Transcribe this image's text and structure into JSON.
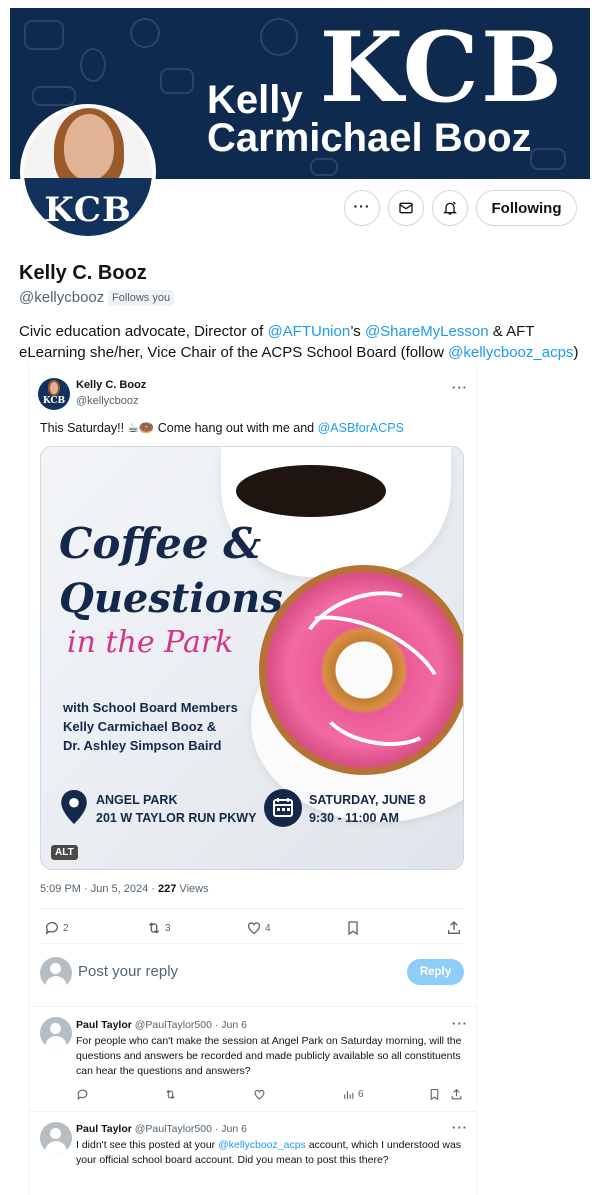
{
  "banner": {
    "logo_text": "KCB",
    "name_line1": "Kelly",
    "name_line2": "Carmichael Booz"
  },
  "avatar": {
    "logo_text": "KCB"
  },
  "actions": {
    "following_label": "Following",
    "more_icon": "more-icon",
    "message_icon": "message-icon",
    "notify_icon": "notify-icon"
  },
  "profile": {
    "name": "Kelly C. Booz",
    "handle": "@kellycbooz",
    "follows_you": "Follows you"
  },
  "bio": {
    "p1": "Civic education advocate, Director of ",
    "m1": "@AFTUnion",
    "p2": "’s ",
    "m2": "@ShareMyLesson",
    "p3": " & AFT eLearning she/her, Vice Chair of the ACPS School Board (follow ",
    "m3": "@kellycbooz_acps",
    "p4": ")"
  },
  "tweet": {
    "author_name": "Kelly C. Booz",
    "author_handle": "@kellycbooz",
    "avatar_text": "KCB",
    "text_prefix": "This Saturday!! ☕🍩 Come hang out with me and ",
    "mention": "@ASBforACPS",
    "image": {
      "title_line1": "Coffee &",
      "title_line2": "Questions",
      "title_line3": "in the Park",
      "sub_line1": "with School Board Members",
      "sub_line2": "Kelly Carmichael Booz &",
      "sub_line3": "Dr. Ashley Simpson Baird",
      "loc_line1": "ANGEL PARK",
      "loc_line2": "201 W TAYLOR RUN PKWY",
      "date_line1": "SATURDAY, JUNE 8",
      "date_line2": "9:30 - 11:00 AM",
      "alt_badge": "ALT"
    },
    "meta_time": "5:09 PM · Jun 5, 2024 · ",
    "views_count": "227",
    "views_label": " Views",
    "stats": {
      "replies": "2",
      "retweets": "3",
      "likes": "4"
    }
  },
  "reply_box": {
    "placeholder": "Post your reply",
    "button": "Reply"
  },
  "replies": [
    {
      "name": "Paul Taylor",
      "handle_date": "@PaulTaylor500 · Jun 6",
      "text": "For people who can't make the session at Angel Park on Saturday morning, will the questions and answers be recorded and made publicly available so all constituents can hear the questions and answers?",
      "views": "6"
    },
    {
      "name": "Paul Taylor",
      "handle_date": "@PaulTaylor500 · Jun 6",
      "text_prefix": "I didn't see this posted at your ",
      "mention": "@kellycbooz_acps",
      "text_suffix": " account, which I understood was your official school board account. Did you mean to post this there?"
    }
  ],
  "colors": {
    "link": "#1d9bf0",
    "banner_bg": "#0e2a4f",
    "navy": "#14284b",
    "pink": "#d6338b",
    "reply_btn": "#8ecdf8"
  }
}
